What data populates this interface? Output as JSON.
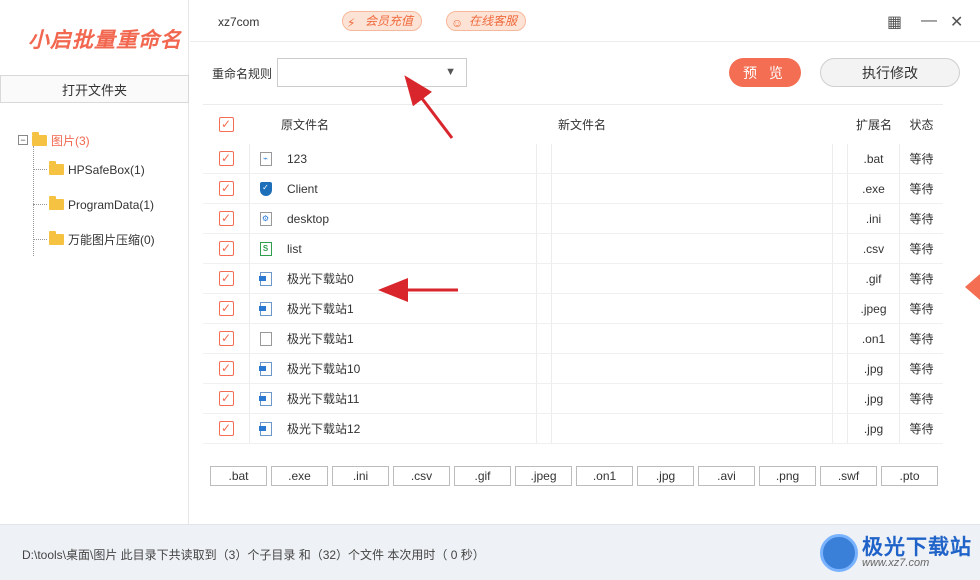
{
  "app": {
    "logo_text": "小启批量重命名",
    "username": "xz7com",
    "vip_label": "会员充值",
    "service_label": "在线客服"
  },
  "sidebar": {
    "open_folder_label": "打开文件夹",
    "tree_root": "图片(3)",
    "tree_children": [
      "HPSafeBox(1)",
      "ProgramData(1)",
      "万能图片压缩(0)"
    ]
  },
  "toolbar": {
    "rule_label": "重命名规则",
    "rule_value": "",
    "preview_label": "预 览",
    "execute_label": "执行修改"
  },
  "table": {
    "headers": {
      "orig": "原文件名",
      "new": "新文件名",
      "ext": "扩展名",
      "status": "状态"
    },
    "rows": [
      {
        "name": "123",
        "new": "",
        "ext": ".bat",
        "status": "等待",
        "icon": "batch-file-icon"
      },
      {
        "name": "Client",
        "new": "",
        "ext": ".exe",
        "status": "等待",
        "icon": "shield-exe-icon"
      },
      {
        "name": "desktop",
        "new": "",
        "ext": ".ini",
        "status": "等待",
        "icon": "ini-file-icon"
      },
      {
        "name": "list",
        "new": "",
        "ext": ".csv",
        "status": "等待",
        "icon": "csv-file-icon"
      },
      {
        "name": "极光下载站0",
        "new": "",
        "ext": ".gif",
        "status": "等待",
        "icon": "image-file-icon"
      },
      {
        "name": "极光下载站1",
        "new": "",
        "ext": ".jpeg",
        "status": "等待",
        "icon": "image-file-icon"
      },
      {
        "name": "极光下载站1",
        "new": "",
        "ext": ".on1",
        "status": "等待",
        "icon": "blank-file-icon"
      },
      {
        "name": "极光下载站10",
        "new": "",
        "ext": ".jpg",
        "status": "等待",
        "icon": "image-file-icon"
      },
      {
        "name": "极光下载站11",
        "new": "",
        "ext": ".jpg",
        "status": "等待",
        "icon": "image-file-icon"
      },
      {
        "name": "极光下载站12",
        "new": "",
        "ext": ".jpg",
        "status": "等待",
        "icon": "image-file-icon"
      }
    ]
  },
  "extensions": [
    ".bat",
    ".exe",
    ".ini",
    ".csv",
    ".gif",
    ".jpeg",
    ".on1",
    ".jpg",
    ".avi",
    ".png",
    ".swf",
    ".pto"
  ],
  "footer": {
    "status_text": "D:\\tools\\桌面\\图片 此目录下共读取到（3）个子目录 和（32）个文件 本次用时（ 0 秒）"
  },
  "watermark": {
    "title": "极光下载站",
    "url": "www.xz7.com"
  },
  "colors": {
    "accent": "#f36e52",
    "brand_blue": "#1f63c9",
    "annotation_arrow": "#d9262c"
  }
}
